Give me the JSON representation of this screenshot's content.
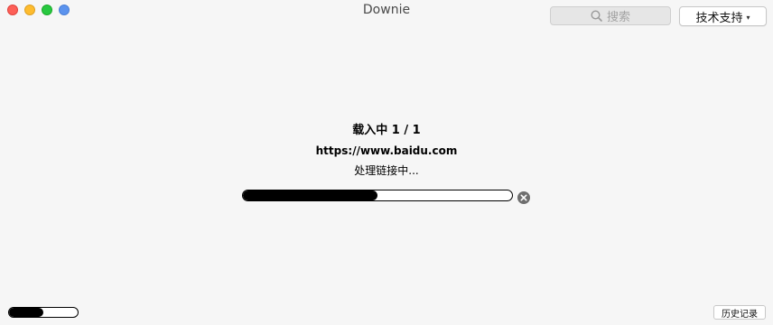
{
  "window": {
    "title": "Downie"
  },
  "toolbar": {
    "search_placeholder": "搜索",
    "support_label": "技术支持",
    "support_caret": "▾"
  },
  "status": {
    "title": "载入中 1 / 1",
    "url": "https://www.baidu.com",
    "message": "处理链接中..."
  },
  "progress": {
    "main_fraction": 0.5,
    "overall_fraction": 0.5
  },
  "footer": {
    "history_label": "历史记录"
  },
  "colors": {
    "close": "#fd5f57",
    "minimize": "#febc2e",
    "zoom": "#28c840",
    "extra": "#5b93ee",
    "progress_fill": "#000000"
  }
}
